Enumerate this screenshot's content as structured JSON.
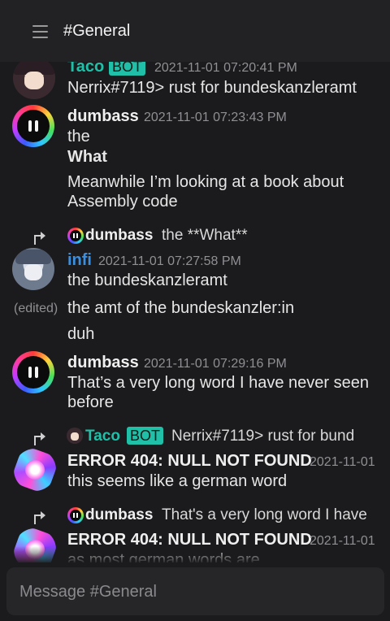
{
  "header": {
    "channel_title": "#General"
  },
  "composer": {
    "placeholder": "Message #General"
  },
  "colors": {
    "bot_badge": "#20c0a8",
    "infi_name": "#3b8fe0",
    "taco_name": "#20c0a8",
    "background": "#1b1b1d"
  },
  "messages": [
    {
      "author": "Taco",
      "badge": "BOT",
      "time": "2021-11-01 07:20:41 PM",
      "lines": [
        "Nerrix#7119> rust for bundeskanzleramt"
      ]
    },
    {
      "author": "dumbass",
      "time": "2021-11-01 07:23:43 PM",
      "lines": [
        "the",
        "What",
        "Meanwhile I’m looking at a book about",
        "Assembly code"
      ]
    },
    {
      "reply_author": "dumbass",
      "reply_text": "the **What**",
      "author": "infi",
      "time": "2021-11-01 07:27:58 PM",
      "lines": [
        "the bundeskanzleramt",
        "the amt of the bundeskanzler:in",
        "duh"
      ],
      "edited_label": "(edited)"
    },
    {
      "author": "dumbass",
      "time": "2021-11-01 07:29:16 PM",
      "lines": [
        "That’s a very long word I have never seen",
        "before"
      ]
    },
    {
      "reply_author": "Taco",
      "reply_badge": "BOT",
      "reply_text": "Nerrix#7119> rust for bund",
      "author": "ERROR 404: NULL NOT FOUND",
      "time": "2021-11-01",
      "lines": [
        "this seems like a german word"
      ]
    },
    {
      "reply_author": "dumbass",
      "reply_text": "That's a very long word I have",
      "author": "ERROR 404: NULL NOT FOUND",
      "time": "2021-11-01",
      "lines": [
        "as most german words are"
      ]
    }
  ]
}
